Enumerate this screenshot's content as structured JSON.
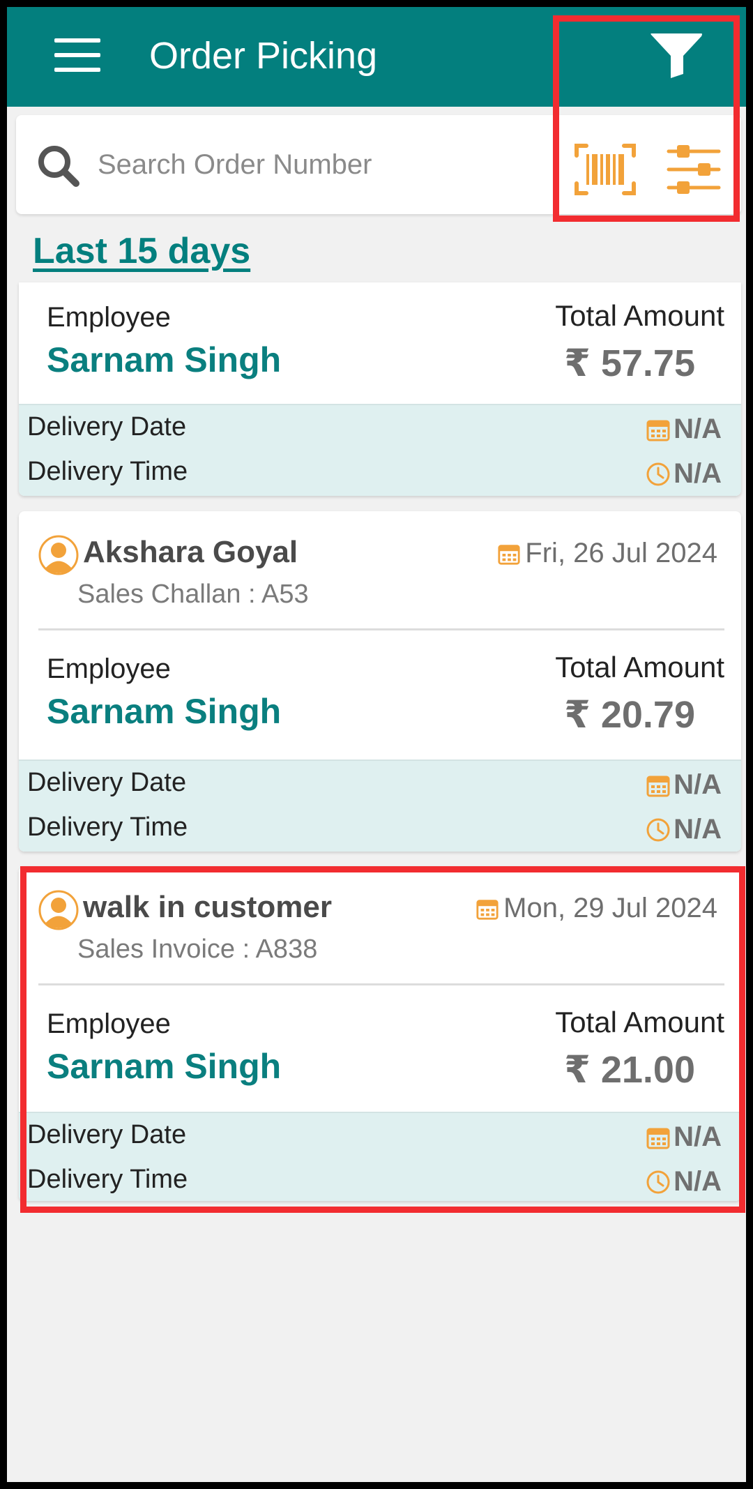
{
  "app": {
    "title": "Order Picking",
    "accent_color": "#037f7e",
    "icon_color": "#f2a23a",
    "highlight_color": "#f22c30"
  },
  "search": {
    "placeholder": "Search Order Number"
  },
  "toolbar_icons": [
    "menu-icon",
    "filter-icon",
    "search-icon",
    "barcode-scan-icon",
    "sliders-icon"
  ],
  "date_range": "Last 15 days",
  "labels": {
    "employee": "Employee",
    "total_amount": "Total Amount",
    "delivery_date": "Delivery Date",
    "delivery_time": "Delivery Time"
  },
  "orders": [
    {
      "employee": "Sarnam Singh",
      "amount": "₹ 57.75",
      "delivery_date": "N/A",
      "delivery_time": "N/A"
    },
    {
      "customer": "Akshara Goyal",
      "doc": "Sales Challan : A53",
      "date": "Fri, 26 Jul 2024",
      "employee": "Sarnam Singh",
      "amount": "₹ 20.79",
      "delivery_date": "N/A",
      "delivery_time": "N/A"
    },
    {
      "customer": "walk in customer",
      "doc": "Sales Invoice : A838",
      "date": "Mon, 29 Jul 2024",
      "employee": "Sarnam Singh",
      "amount": "₹ 21.00",
      "delivery_date": "N/A",
      "delivery_time": "N/A"
    }
  ]
}
